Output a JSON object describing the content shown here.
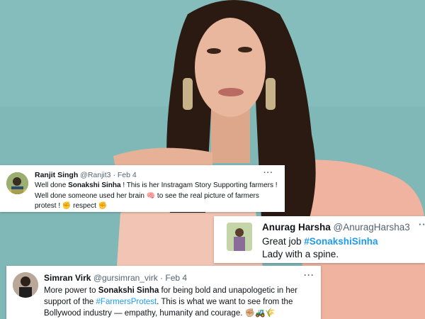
{
  "tweets": [
    {
      "name": "Ranjit Singh",
      "handle": "@Ranjit3",
      "separator": "·",
      "date": "Feb 4",
      "more": "···",
      "text_1": "Well done ",
      "mention_1": "Sonakshi Sinha",
      "text_2": " ! This is her Instragam Story Supporting farmers ! Well done someone used her brain ",
      "emoji_brain": "🧠",
      "text_3": " to see the real picture of farmers protest ! ",
      "emoji_fist_1": "✊",
      "text_4": " respect ",
      "emoji_fist_2": "✊"
    },
    {
      "name": "Anurag Harsha",
      "handle": "@AnuragHarsha3",
      "separator": "·",
      "date": "",
      "more": "···",
      "line_1_prefix": "Great job ",
      "hashtag": "#SonakshiSinha",
      "line_2": "Lady with a spine."
    },
    {
      "name": "Simran Virk",
      "handle": "@gursimran_virk",
      "separator": "·",
      "date": "Feb 4",
      "more": "···",
      "text_1": "More power to ",
      "mention_1": "Sonakshi Sinha",
      "text_2": " for being bold and unapologetic in her support of the ",
      "hashtag": "#FarmersProtest",
      "text_3": ". This is what we want to see from the Bollywood industry — empathy, humanity and courage. ",
      "emoji_fist": "✊🏼",
      "emoji_tractor": "🚜",
      "emoji_wheat": "🌾"
    }
  ],
  "colors": {
    "background_teal": "#7fb8b7",
    "dress_peach": "#efb9a6",
    "hair": "#2a1a14",
    "skin": "#e8b79d",
    "link_blue": "#1d9bf0"
  }
}
